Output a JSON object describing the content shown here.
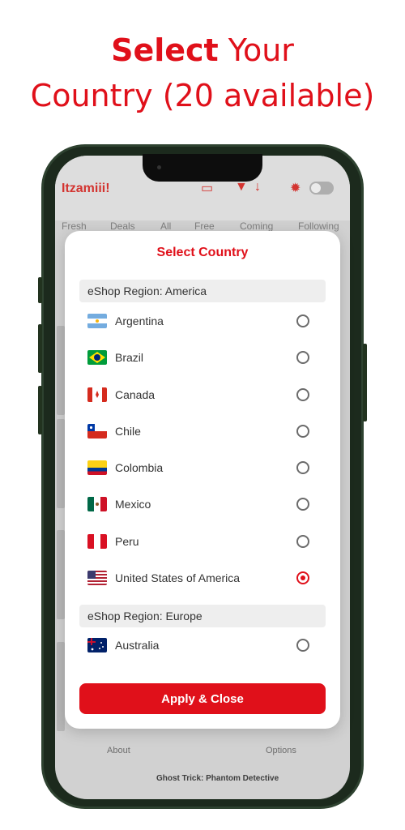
{
  "promo": {
    "title_bold": "Select",
    "title_rest": " Your",
    "title_line2": "Country (20 available)"
  },
  "app": {
    "name": "Itzamiii!",
    "tabs": [
      "Fresh",
      "Deals",
      "All",
      "Free",
      "Coming",
      "Following"
    ],
    "bottom_nav": {
      "about_label": "About",
      "options_label": "Options"
    },
    "behind_item_title": "Ghost Trick: Phantom Detective"
  },
  "modal": {
    "title": "Select Country",
    "regions": [
      {
        "label": "eShop Region: America",
        "countries": [
          {
            "name": "Argentina",
            "flag": "flag-argentina",
            "selected": false
          },
          {
            "name": "Brazil",
            "flag": "flag-brazil",
            "selected": false
          },
          {
            "name": "Canada",
            "flag": "flag-canada",
            "selected": false
          },
          {
            "name": "Chile",
            "flag": "flag-chile",
            "selected": false
          },
          {
            "name": "Colombia",
            "flag": "flag-colombia",
            "selected": false
          },
          {
            "name": "Mexico",
            "flag": "flag-mexico",
            "selected": false
          },
          {
            "name": "Peru",
            "flag": "flag-peru",
            "selected": false
          },
          {
            "name": "United States of America",
            "flag": "flag-usa",
            "selected": true
          }
        ]
      },
      {
        "label": "eShop Region: Europe",
        "countries": [
          {
            "name": "Australia",
            "flag": "flag-australia",
            "selected": false
          }
        ]
      }
    ],
    "apply_label": "Apply & Close"
  },
  "colors": {
    "accent": "#e0101a",
    "region_bg": "#eeeeee"
  }
}
